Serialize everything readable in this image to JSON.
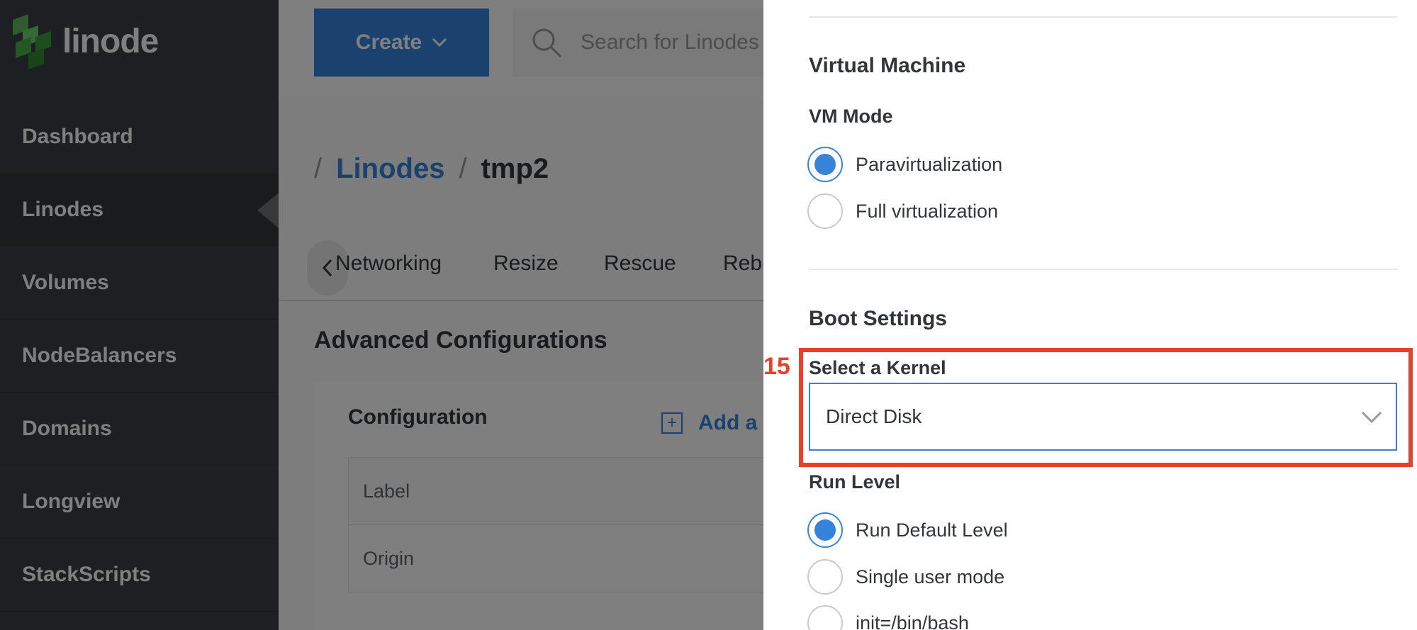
{
  "sidebar": {
    "logo_text": "linode",
    "items": [
      {
        "label": "Dashboard"
      },
      {
        "label": "Linodes",
        "active": true
      },
      {
        "label": "Volumes"
      },
      {
        "label": "NodeBalancers"
      },
      {
        "label": "Domains"
      },
      {
        "label": "Longview"
      },
      {
        "label": "StackScripts"
      }
    ]
  },
  "topbar": {
    "create_label": "Create",
    "search_placeholder": "Search for Linodes"
  },
  "breadcrumb": {
    "parent": "Linodes",
    "current": "tmp2"
  },
  "tabs": [
    "Networking",
    "Resize",
    "Rescue",
    "Rebuild"
  ],
  "main": {
    "section_title": "Advanced Configurations",
    "panel_title": "Configuration",
    "add_label": "Add a Configuration",
    "row_label": "Label",
    "row_origin": "Origin"
  },
  "drawer": {
    "vm_heading": "Virtual Machine",
    "vm_mode_label": "VM Mode",
    "vm_modes": [
      {
        "label": "Paravirtualization",
        "checked": true
      },
      {
        "label": "Full virtualization",
        "checked": false
      }
    ],
    "boot_heading": "Boot Settings",
    "kernel_label": "Select a Kernel",
    "kernel_value": "Direct Disk",
    "run_level_label": "Run Level",
    "run_levels": [
      {
        "label": "Run Default Level",
        "checked": true
      },
      {
        "label": "Single user mode",
        "checked": false
      },
      {
        "label": "init=/bin/bash",
        "checked": false
      }
    ]
  },
  "annotation": {
    "number": "15"
  },
  "colors": {
    "accent": "#3683dc",
    "sidebar": "#3a3f45",
    "annotation": "#e8402a"
  }
}
